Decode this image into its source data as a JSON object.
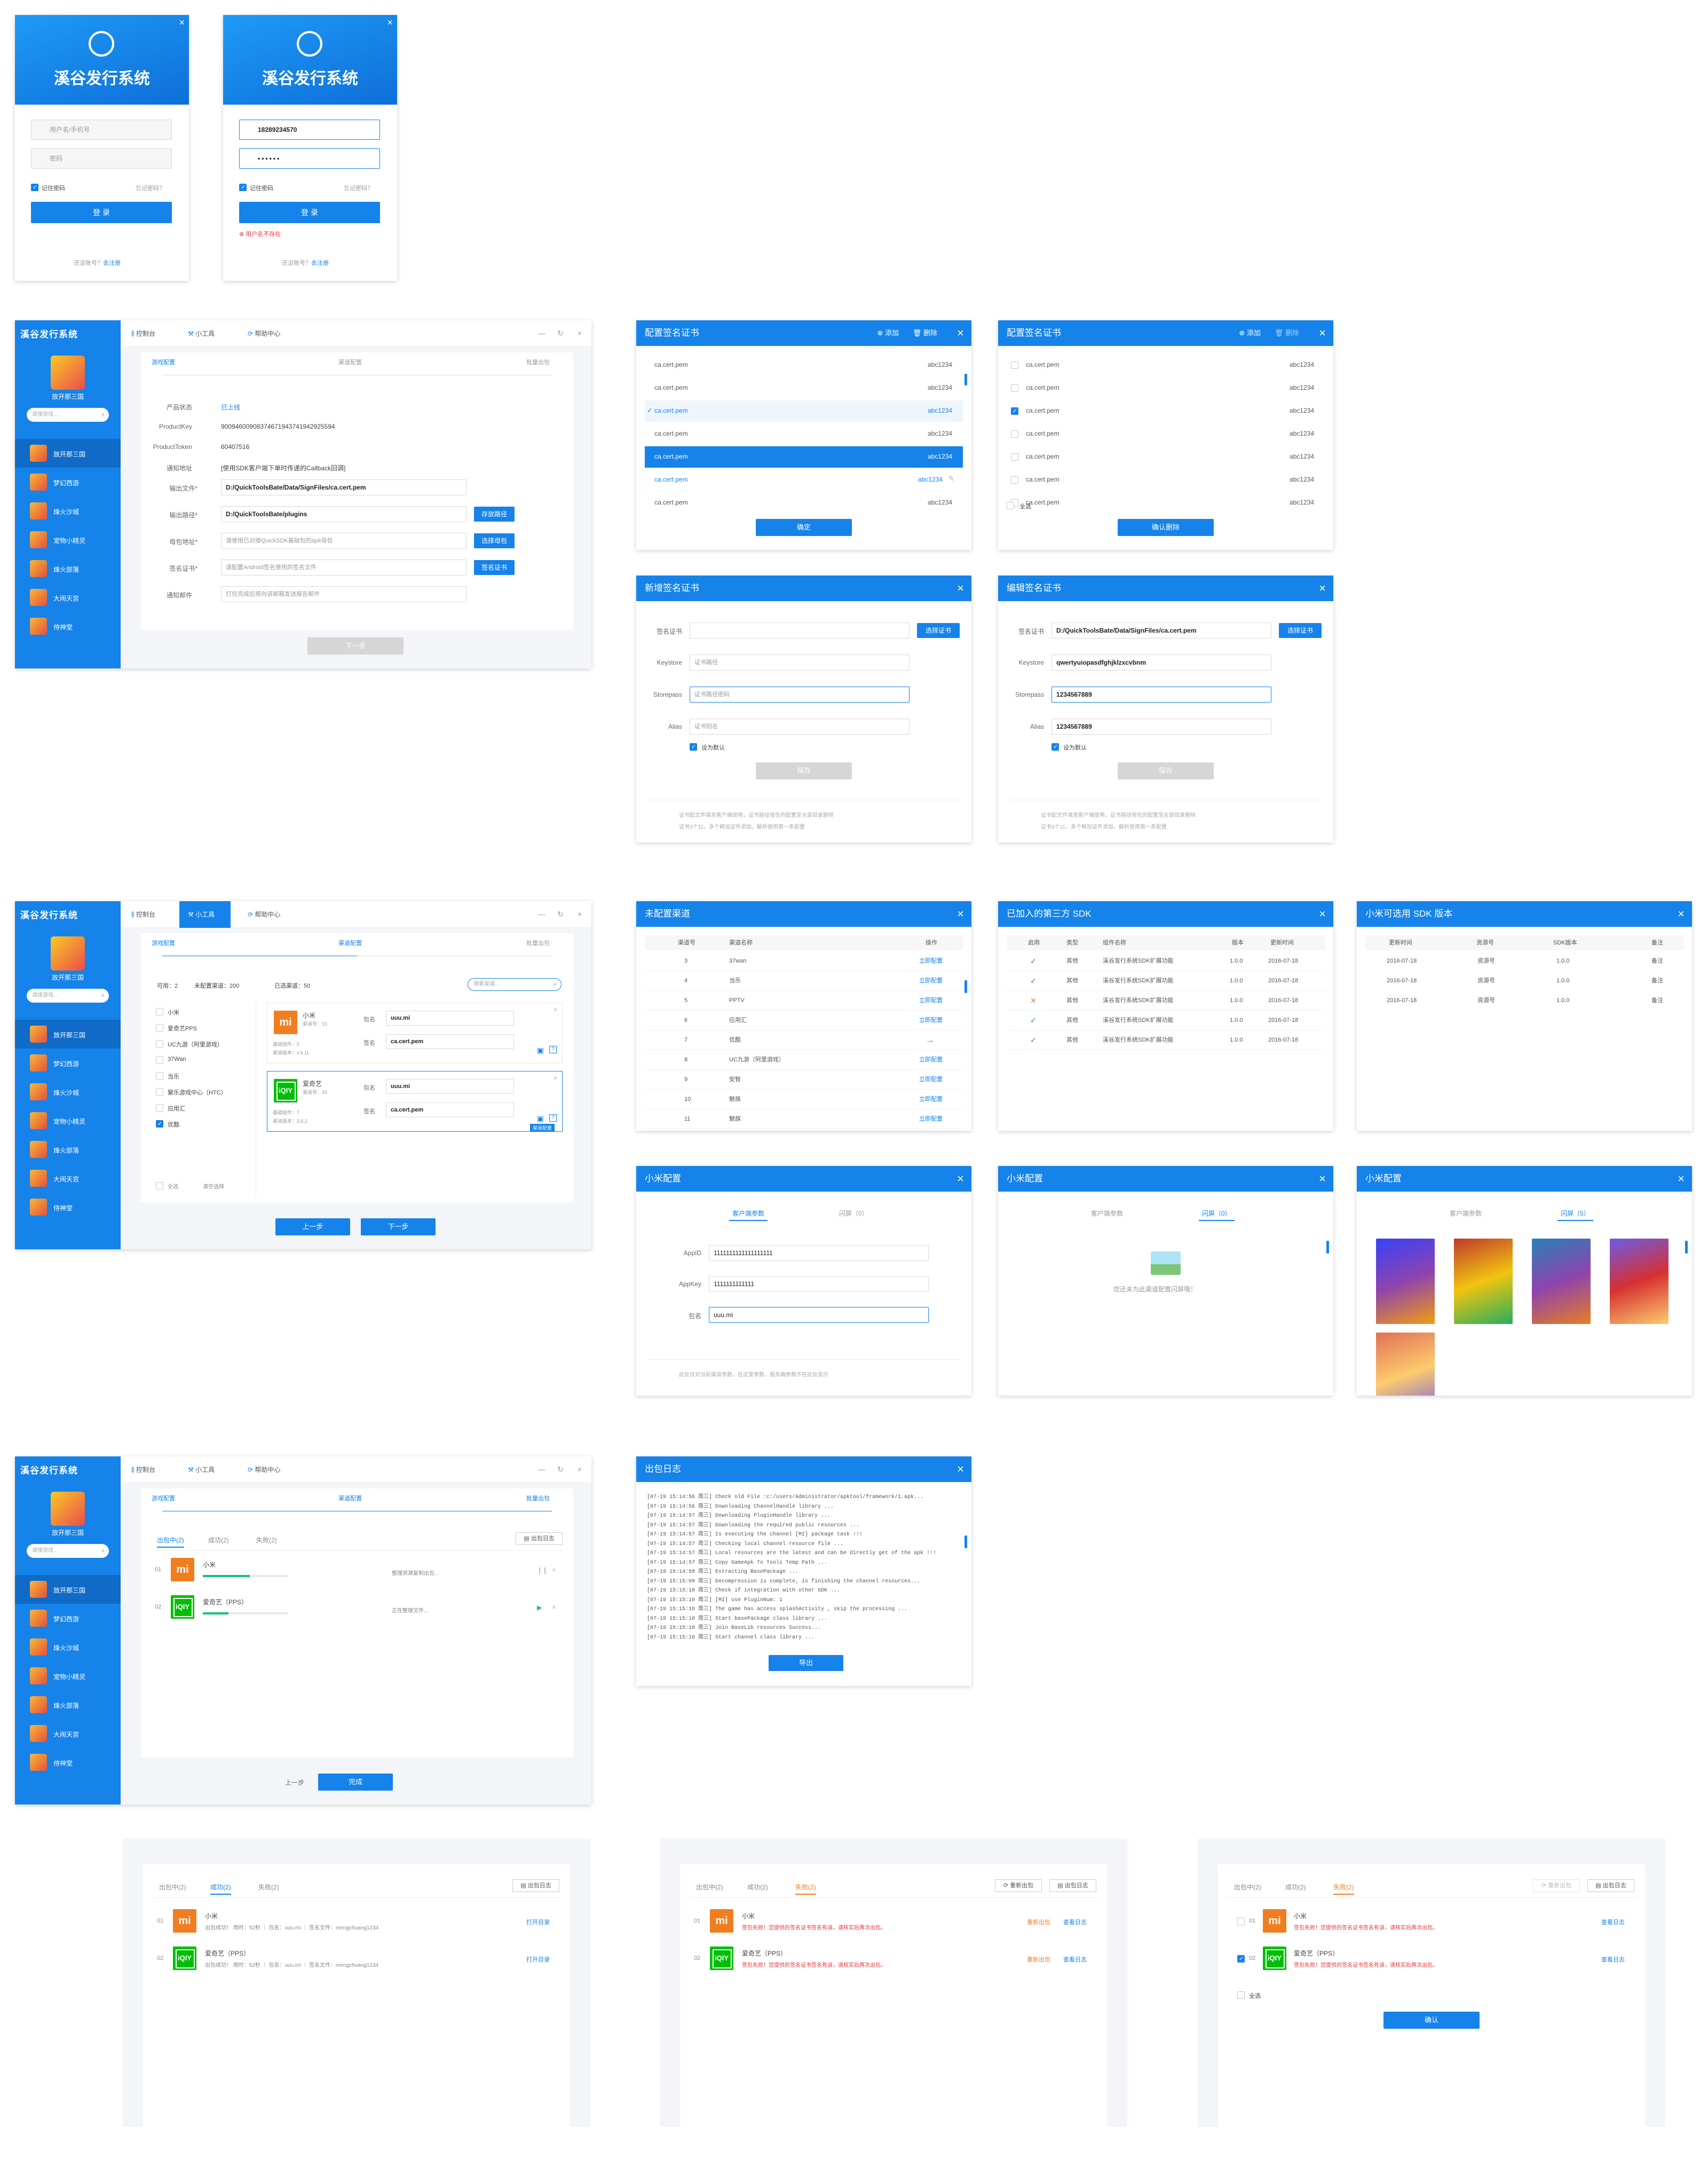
{
  "app": {
    "name": "溪谷发行系统"
  },
  "login": {
    "user_placeholder": "用户名/手机号",
    "pwd_placeholder": "密码",
    "remember": "记住密码",
    "forgot": "忘记密码？",
    "login_btn": "登 录",
    "no_account": "还没账号？",
    "register": "去注册",
    "phone_value": "18289234570",
    "pwd_value": "••••••",
    "error": "用户名不存在"
  },
  "nav": {
    "console": "控制台",
    "tools": "小工具",
    "help": "帮助中心",
    "game_name": "放开那三国",
    "search_placeholder": "请搜游戏...",
    "games": [
      "放开那三国",
      "梦幻西游",
      "烽火沙城",
      "宠物小精灵",
      "烽火部落",
      "大闹天宫",
      "侍神堂"
    ]
  },
  "steps": [
    "游戏配置",
    "渠道配置",
    "批量出包"
  ],
  "game_config": {
    "status_label": "产品状态",
    "status_value": "已上线",
    "key_label": "ProductKey",
    "key_value": "90094600908374671943741942925594",
    "token_label": "ProductToken",
    "token_value": "60407516",
    "notify_label": "通知地址",
    "notify_value": "[使用SDK客户端下单时传递的Callback回调]",
    "out_file_label": "输出文件*",
    "out_file_value": "D:/QuickToolsBate/Data/SignFiles/ca.cert.pem",
    "out_path_label": "输出路径*",
    "out_path_value": "D:/QuickToolsBate/plugins",
    "out_path_btn": "存放路径",
    "parent_label": "母包地址*",
    "parent_placeholder": "请使用已对接QuickSDK基础包的apk母包",
    "parent_btn": "选择母包",
    "sign_label": "签名证书*",
    "sign_placeholder": "请配置Android签名使用的签名文件",
    "sign_btn": "签名证书",
    "mail_label": "通知邮件",
    "mail_placeholder": "打包完成后将向该邮箱发送报告邮件",
    "next": "下一步"
  },
  "cert_list": {
    "title": "配置签名证书",
    "add": "添加",
    "del": "删除",
    "items": [
      {
        "name": "ca.cert.pem",
        "pwd": "abc1234"
      },
      {
        "name": "ca.cert.pem",
        "pwd": "abc1234"
      },
      {
        "name": "ca.cert.pem",
        "pwd": "abc1234"
      },
      {
        "name": "ca.cert.pem",
        "pwd": "abc1234"
      },
      {
        "name": "ca.cert.pem",
        "pwd": "abc1234"
      },
      {
        "name": "ca.cert.pem",
        "pwd": "abc1234"
      },
      {
        "name": "ca.cert.pem",
        "pwd": "abc1234"
      }
    ],
    "confirm": "确定",
    "select_all": "全选",
    "confirm_del": "确认删除"
  },
  "cert_form": {
    "new_title": "新增签名证书",
    "edit_title": "编辑签名证书",
    "cert_label": "签名证书",
    "cert_btn": "选择证书",
    "keystore_label": "Keystore",
    "keystore_ph": "证书路径",
    "storepass_label": "Storepass",
    "storepass_ph": "证书路径密码",
    "alias_label": "Alias",
    "alias_ph": "证书别名",
    "default": "设为默认",
    "save": "保存",
    "edit_cert": "D:/QuickToolsBate/Data/SignFiles/ca.cert.pem",
    "edit_keystore": "qwertyuiopasdfghjklzxcvbnm",
    "edit_storepass": "1234567889",
    "edit_alias": "1234567889",
    "tip1": "证书配文件填发客户端使用，证书路径按在的配置至全部目录删除",
    "tip2": "证书3个11，多个释加证件添加，解析使用第一条配置"
  },
  "channel_config": {
    "available": "可用：2",
    "unconfigured": "未配置渠道：200",
    "chosen": "已选渠道：50",
    "search_ph": "搜索渠道...",
    "list": [
      "小米",
      "爱奇艺PPS",
      "UC九游（阿里游戏）",
      "37Wan",
      "当乐",
      "聚乐游戏中心（HTC）",
      "应用汇",
      "优酷"
    ],
    "cards": [
      {
        "name": "小米",
        "sub1": "渠道号：15",
        "sub2": "基础组件：5",
        "sub3": "渠道版本：v.6.11",
        "pkg_label": "包名",
        "pkg": "uuu.mi",
        "sign_label": "签名",
        "sign": "ca.cert.pem"
      },
      {
        "name": "爱奇艺",
        "sub1": "渠道号：33",
        "sub2": "基础组件：7",
        "sub3": "渠道版本：3.6.2",
        "pkg_label": "包名",
        "pkg": "uuu.mi",
        "sign_label": "签名",
        "sign": "ca.cert.pem"
      }
    ],
    "tag": "渠道配置",
    "all": "全选",
    "clear": "清空选择",
    "prev": "上一步",
    "next": "下一步"
  },
  "unconfigured": {
    "title": "未配置渠道",
    "h_no": "渠道号",
    "h_name": "渠道名称",
    "h_op": "操作",
    "rows": [
      {
        "no": "3",
        "name": "37wan",
        "op": "立即配置"
      },
      {
        "no": "4",
        "name": "当乐",
        "op": "立即配置"
      },
      {
        "no": "5",
        "name": "PPTV",
        "op": "立即配置"
      },
      {
        "no": "6",
        "name": "应用汇",
        "op": "立即配置"
      },
      {
        "no": "7",
        "name": "优酷",
        "op": ""
      },
      {
        "no": "8",
        "name": "UC九游（阿里游戏）",
        "op": "立即配置"
      },
      {
        "no": "9",
        "name": "安智",
        "op": "立即配置"
      },
      {
        "no": "10",
        "name": "魅族",
        "op": "立即配置"
      },
      {
        "no": "11",
        "name": "魅族",
        "op": "立即配置"
      }
    ]
  },
  "third_sdk": {
    "title": "已加入的第三方 SDK",
    "h": [
      "启用",
      "类型",
      "组件名称",
      "版本",
      "更新时间"
    ],
    "rows": [
      {
        "on": true,
        "type": "其他",
        "name": "溪谷发行系统SDK扩展功能",
        "ver": "1.0.0",
        "date": "2016-07-18"
      },
      {
        "on": true,
        "type": "其他",
        "name": "溪谷发行系统SDK扩展功能",
        "ver": "1.0.0",
        "date": "2016-07-18"
      },
      {
        "on": false,
        "type": "其他",
        "name": "溪谷发行系统SDK扩展功能",
        "ver": "1.0.0",
        "date": "2016-07-18"
      },
      {
        "on": true,
        "type": "其他",
        "name": "溪谷发行系统SDK扩展功能",
        "ver": "1.0.0",
        "date": "2016-07-18"
      },
      {
        "on": true,
        "type": "其他",
        "name": "溪谷发行系统SDK扩展功能",
        "ver": "1.0.0",
        "date": "2016-07-18"
      }
    ]
  },
  "mi_sdk": {
    "title": "小米可选用 SDK 版本",
    "h": [
      "更新时间",
      "资源号",
      "SDK版本",
      "备注"
    ],
    "rows": [
      {
        "date": "2016-07-18",
        "res": "资源号",
        "ver": "1.0.0",
        "note": "备注"
      },
      {
        "date": "2016-07-18",
        "res": "资源号",
        "ver": "1.0.0",
        "note": "备注"
      },
      {
        "date": "2016-07-18",
        "res": "资源号",
        "ver": "1.0.0",
        "note": "备注"
      }
    ]
  },
  "mi_config": {
    "title": "小米配置",
    "tab1": "客户端参数",
    "tab2": "闪屏（0）",
    "tab2b": "闪屏（5）",
    "appid_label": "AppID",
    "appid": "1111111111111111111",
    "appkey_label": "AppKey",
    "appkey": "1111111111111",
    "pkg_label": "包名",
    "pkg": "uuu.mi",
    "tip": "此处仅对当前渠道参数，在这里参数，服务端参数不在此处显示",
    "empty": "您还未为此渠道配置闪屏哦！"
  },
  "build": {
    "tab_building": "出包中(2)",
    "tab_ok": "成功(2)",
    "tab_fail": "失败(2)",
    "log_btn": "出包日志",
    "rebuild_btn": "重新出包",
    "items": [
      {
        "no": "01",
        "name": "小米",
        "status": "整理资源复制出包...",
        "progress": 0.55
      },
      {
        "no": "02",
        "name": "爱奇艺（PPS）",
        "status": "正在整理文件...",
        "progress": 0.3
      }
    ],
    "prev": "上一步",
    "finish": "完成"
  },
  "log": {
    "title": "出包日志",
    "lines": [
      "[07-19 15:14:56 周三] Check old File :c:/users/Administrator/apktool/framework/1.apk...",
      "[07-19 15:14:56 周三] Downloading ChannelHandle library ...",
      "[07-19 15:14:57 周三] Downloading PluginHandle library ...",
      "[07-19 15:14:57 周三] Downloading the required public resources ...",
      "[07-19 15:14:57 周三] Is executing the channel [MI] package task !!!",
      "[07-19 15:14:57 周三] Checking local channel resource file ...",
      "[07-19 15:14:57 周三] Local resources are the latest and can be directly get of the apk !!!",
      "[07-19 15:14:57 周三] Copy GameApk To Tools Temp Path ...",
      "[07-19 15:14:58 周三] Extracting BasePackage ...",
      "[07-19 15:15:09 周三] Decompression is complete, is finishing the channel resources...",
      "[07-19 15:15:10 周三] Check if integration with other SDK ...",
      "[07-19 15:15:10 周三] [MI] use PluginNum: 1",
      "[07-19 15:15:10 周三] The game has access splashActivity , skip the processing ...",
      "[07-19 15:15:10 周三] Start basePackage class library ...",
      "[07-19 15:15:10 周三] Join BaseLib resources Success...",
      "[07-19 15:15:10 周三] Start channel class library ..."
    ],
    "export": "导出"
  },
  "results": {
    "success_items": [
      {
        "no": "01",
        "name": "小米",
        "line": "出包成功！ 用时：52秒 ｜ 包名：uuu.mi ｜ 签名文件：mengchuang1234",
        "action": "打开目录"
      },
      {
        "no": "02",
        "name": "爱奇艺（PPS）",
        "line": "出包成功！ 用时：52秒 ｜ 包名：uuu.mi ｜ 签名文件：mengchuang1234",
        "action": "打开目录"
      }
    ],
    "fail_items": [
      {
        "no": "01",
        "name": "小米",
        "line": "签包失败！您提供的签名证书签名有误，请核实后再次出包。",
        "a1": "重新出包",
        "a2": "查看日志"
      },
      {
        "no": "02",
        "name": "爱奇艺（PPS）",
        "line": "签包失败！您提供的签名证书签名有误，请核实后再次出包。",
        "a1": "重新出包",
        "a2": "查看日志"
      }
    ],
    "select_all": "全选",
    "confirm": "确认"
  },
  "colors": {
    "primary": "#1583e9",
    "orange": "#f07e21",
    "green": "#00be06",
    "red": "#e5383b"
  }
}
